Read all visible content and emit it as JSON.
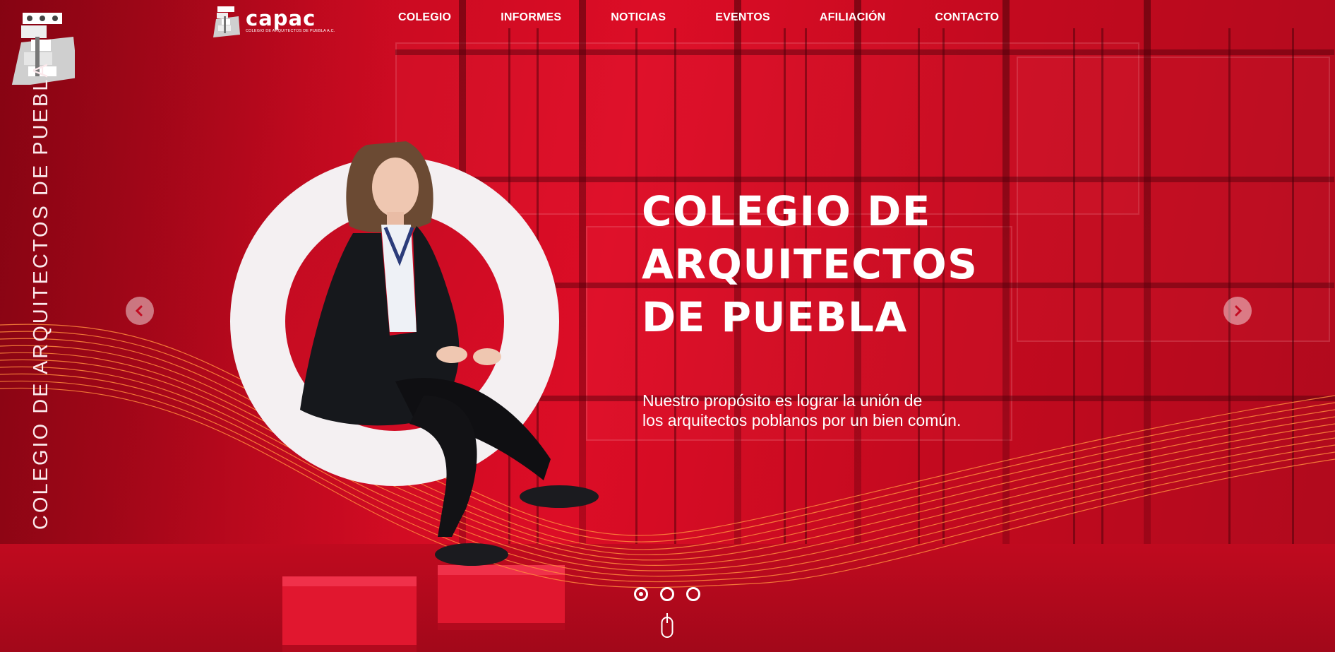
{
  "brand": {
    "name": "capac",
    "tagline": "COLEGIO DE ARQUITECTOS DE PUEBLA A.C."
  },
  "sidebar": {
    "vertical_title": "COLEGIO DE ARQUITECTOS DE PUEBLA"
  },
  "nav": {
    "items": [
      {
        "label": "COLEGIO"
      },
      {
        "label": "INFORMES"
      },
      {
        "label": "NOTICIAS"
      },
      {
        "label": "EVENTOS"
      },
      {
        "label": "AFILIACIÓN"
      },
      {
        "label": "CONTACTO"
      }
    ]
  },
  "hero": {
    "title_lines": [
      "COLEGIO DE",
      "ARQUITECTOS",
      "DE PUEBLA"
    ],
    "subtitle_lines": [
      "Nuestro propósito es lograr la unión de",
      "los arquitectos poblanos por un bien común."
    ]
  },
  "slider": {
    "slide_count": 3,
    "active_index": 0,
    "prev_icon": "chevron-left-icon",
    "next_icon": "chevron-right-icon"
  },
  "colors": {
    "brand_red": "#d80d25",
    "ring": "#f4f0f2",
    "text": "#ffffff",
    "wave": "#ff8a3c"
  }
}
